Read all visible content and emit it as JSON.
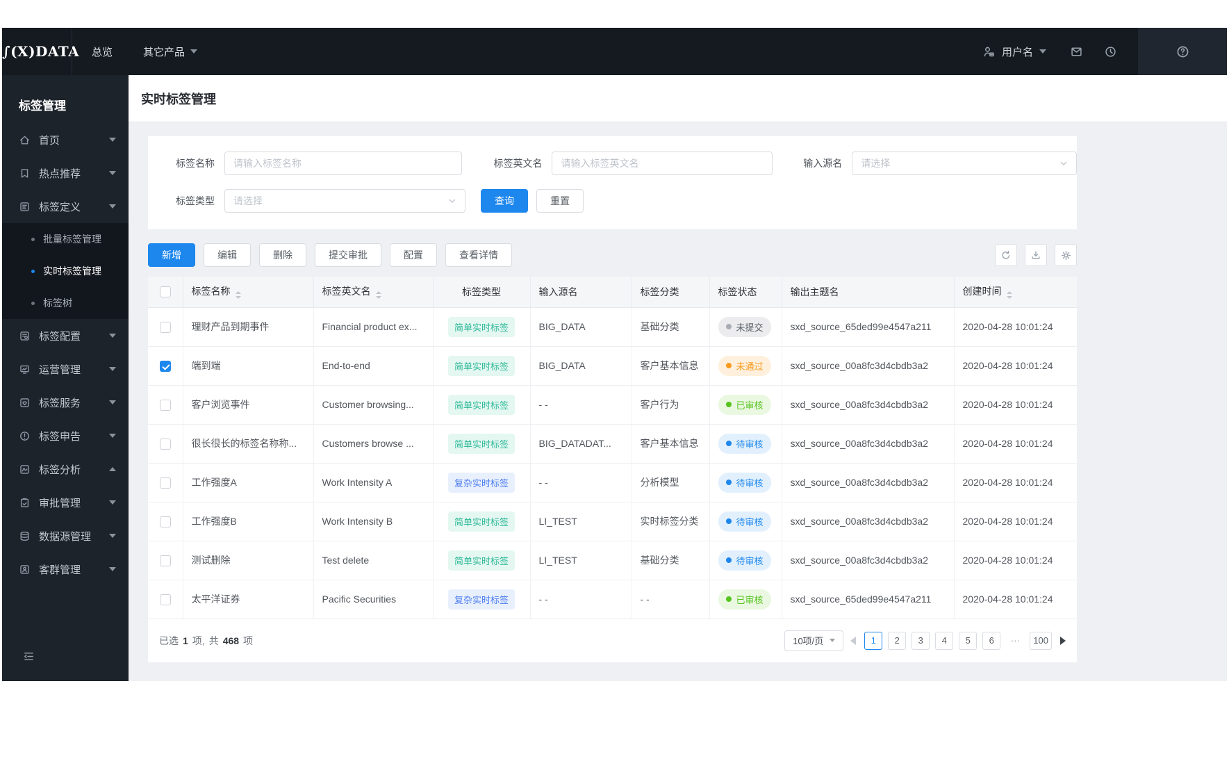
{
  "colors": {
    "accent": "#1d87ee",
    "topbar_bg": "#151a21",
    "sidebar_bg": "#1d232b",
    "submenu_bg": "#12161d",
    "content_bg": "#eef0f3",
    "badge_simple": "#2bb896",
    "badge_complex": "#4a7cf0",
    "status_gray": "#a9adb3",
    "status_orange": "#f99a1f",
    "status_green": "#55c41e",
    "status_blue": "#1d87ee"
  },
  "topnav": {
    "logo": "∫(X)DATA",
    "menu": [
      {
        "label": "总览"
      },
      {
        "label": "其它产品"
      }
    ],
    "username": "用户名",
    "right_icons": [
      "user-icon",
      "mail-icon",
      "clock-icon",
      "help-icon"
    ]
  },
  "sidebar": {
    "title": "标签管理",
    "items": [
      {
        "label": "首页",
        "icon": "home-icon",
        "caret": "down"
      },
      {
        "label": "热点推荐",
        "icon": "bookmark-icon",
        "caret": "down"
      },
      {
        "label": "标签定义",
        "icon": "tag-define-icon",
        "caret": "down",
        "children": [
          {
            "label": "批量标签管理",
            "active": false
          },
          {
            "label": "实时标签管理",
            "active": true
          },
          {
            "label": "标签树",
            "active": false
          }
        ]
      },
      {
        "label": "标签配置",
        "icon": "tag-config-icon",
        "caret": "down"
      },
      {
        "label": "运营管理",
        "icon": "operation-icon",
        "caret": "down"
      },
      {
        "label": "标签服务",
        "icon": "tag-service-icon",
        "caret": "down"
      },
      {
        "label": "标签申告",
        "icon": "tag-report-icon",
        "caret": "down"
      },
      {
        "label": "标签分析",
        "icon": "tag-analysis-icon",
        "caret": "up"
      },
      {
        "label": "审批管理",
        "icon": "approval-icon",
        "caret": "down"
      },
      {
        "label": "数据源管理",
        "icon": "datasource-icon",
        "caret": "down"
      },
      {
        "label": "客群管理",
        "icon": "customer-group-icon",
        "caret": "down"
      }
    ],
    "collapse_icon": "collapse-icon"
  },
  "page": {
    "title": "实时标签管理"
  },
  "filters": {
    "tag_name": {
      "label": "标签名称",
      "placeholder": "请输入标签名称",
      "value": ""
    },
    "tag_name_en": {
      "label": "标签英文名",
      "placeholder": "请输入标签英文名",
      "value": ""
    },
    "input_source": {
      "label": "输入源名",
      "placeholder": "请选择"
    },
    "tag_type": {
      "label": "标签类型",
      "placeholder": "请选择"
    },
    "search_label": "查询",
    "reset_label": "重置"
  },
  "toolbar": {
    "buttons": [
      {
        "label": "新增",
        "primary": true
      },
      {
        "label": "编辑"
      },
      {
        "label": "删除"
      },
      {
        "label": "提交审批"
      },
      {
        "label": "配置"
      },
      {
        "label": "查看详情"
      }
    ],
    "icon_buttons": [
      "refresh-icon",
      "download-icon",
      "settings-icon"
    ]
  },
  "table": {
    "columns": [
      {
        "type": "checkbox",
        "label": ""
      },
      {
        "label": "标签名称",
        "sortable": true
      },
      {
        "label": "标签英文名",
        "sortable": true
      },
      {
        "label": "标签类型",
        "align": "center"
      },
      {
        "label": "输入源名"
      },
      {
        "label": "标签分类"
      },
      {
        "label": "标签状态"
      },
      {
        "label": "输出主题名"
      },
      {
        "label": "创建时间",
        "sortable": true
      }
    ],
    "rows": [
      {
        "checked": false,
        "name": "理财产品到期事件",
        "name_en": "Financial product ex...",
        "type": {
          "label": "简单实时标签",
          "variant": "simple"
        },
        "source": "BIG_DATA",
        "category": "基础分类",
        "status": {
          "label": "未提交",
          "variant": "gray"
        },
        "topic": "sxd_source_65ded99e4547a211",
        "created": "2020-04-28 10:01:24"
      },
      {
        "checked": true,
        "name": "端到端",
        "name_en": "End-to-end",
        "type": {
          "label": "简单实时标签",
          "variant": "simple"
        },
        "source": "BIG_DATA",
        "category": "客户基本信息",
        "status": {
          "label": "未通过",
          "variant": "orange"
        },
        "topic": "sxd_source_00a8fc3d4cbdb3a2",
        "created": "2020-04-28 10:01:24"
      },
      {
        "checked": false,
        "name": "客户浏览事件",
        "name_en": "Customer browsing...",
        "type": {
          "label": "简单实时标签",
          "variant": "simple"
        },
        "source": "- -",
        "category": "客户行为",
        "status": {
          "label": "已审核",
          "variant": "green"
        },
        "topic": "sxd_source_00a8fc3d4cbdb3a2",
        "created": "2020-04-28 10:01:24"
      },
      {
        "checked": false,
        "name": "很长很长的标签名称称...",
        "name_en": "Customers browse ...",
        "type": {
          "label": "简单实时标签",
          "variant": "simple"
        },
        "source": "BIG_DATADAT...",
        "category": "客户基本信息",
        "status": {
          "label": "待审核",
          "variant": "blue"
        },
        "topic": "sxd_source_00a8fc3d4cbdb3a2",
        "created": "2020-04-28 10:01:24"
      },
      {
        "checked": false,
        "name": "工作强度A",
        "name_en": "Work Intensity A",
        "type": {
          "label": "复杂实时标签",
          "variant": "complex"
        },
        "source": "- -",
        "category": "分析模型",
        "status": {
          "label": "待审核",
          "variant": "blue"
        },
        "topic": "sxd_source_00a8fc3d4cbdb3a2",
        "created": "2020-04-28 10:01:24"
      },
      {
        "checked": false,
        "name": "工作强度B",
        "name_en": "Work Intensity B",
        "type": {
          "label": "简单实时标签",
          "variant": "simple"
        },
        "source": "LI_TEST",
        "category": "实时标签分类",
        "status": {
          "label": "待审核",
          "variant": "blue"
        },
        "topic": "sxd_source_00a8fc3d4cbdb3a2",
        "created": "2020-04-28 10:01:24"
      },
      {
        "checked": false,
        "name": "测试删除",
        "name_en": "Test delete",
        "type": {
          "label": "简单实时标签",
          "variant": "simple"
        },
        "source": "LI_TEST",
        "category": "基础分类",
        "status": {
          "label": "待审核",
          "variant": "blue"
        },
        "topic": "sxd_source_00a8fc3d4cbdb3a2",
        "created": "2020-04-28 10:01:24"
      },
      {
        "checked": false,
        "name": "太平洋证券",
        "name_en": "Pacific Securities",
        "type": {
          "label": "复杂实时标签",
          "variant": "complex"
        },
        "source": "- -",
        "category": "- -",
        "status": {
          "label": "已审核",
          "variant": "green"
        },
        "topic": "sxd_source_65ded99e4547a211",
        "created": "2020-04-28 10:01:24"
      }
    ]
  },
  "footer": {
    "selected_label": "已选",
    "selected_count": "1",
    "selected_unit": "项,",
    "total_label": "共",
    "total_count": "468",
    "total_unit": "项",
    "page_size": "10项/页",
    "pages": [
      {
        "label": "1",
        "active": true
      },
      {
        "label": "2"
      },
      {
        "label": "3"
      },
      {
        "label": "4"
      },
      {
        "label": "5"
      },
      {
        "label": "6"
      },
      {
        "label": "···",
        "ellipsis": true
      },
      {
        "label": "100"
      }
    ]
  }
}
